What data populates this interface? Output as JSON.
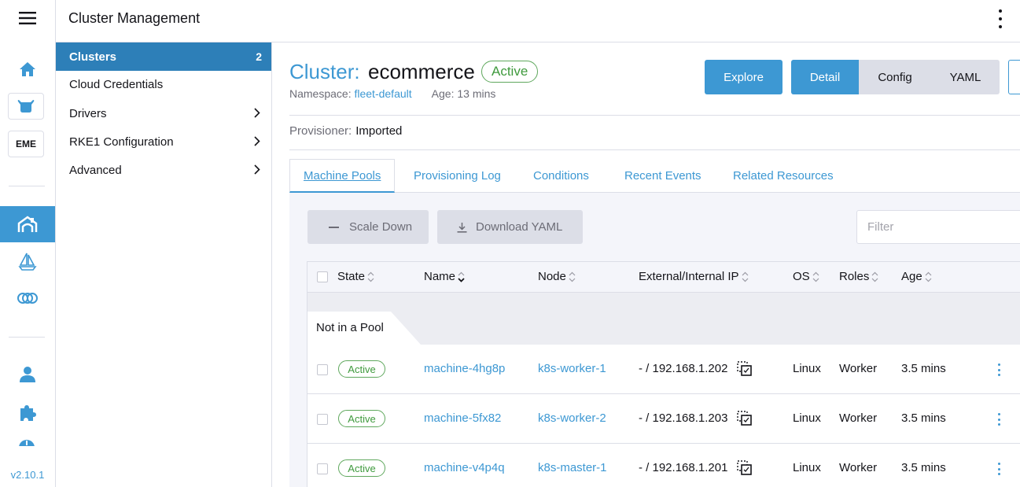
{
  "app": {
    "product_title": "Cluster Management",
    "version": "v2.10.1",
    "rail_cluster_tile": "EME"
  },
  "icons": {
    "menu": "hamburger-icon",
    "home": "home-icon",
    "cluster_rancher": "cattle-icon",
    "cluster_mgmt": "cluster-management-icon",
    "fleet": "sailboat-icon",
    "virtualization": "harvester-icon",
    "users": "user-icon",
    "extensions": "puzzle-icon",
    "more": "kebab-icon"
  },
  "sidenav": {
    "items": [
      {
        "label": "Clusters",
        "count": "2"
      },
      {
        "label": "Cloud Credentials"
      },
      {
        "label": "Drivers"
      },
      {
        "label": "RKE1 Configuration"
      },
      {
        "label": "Advanced"
      }
    ]
  },
  "cluster": {
    "prefix": "Cluster:",
    "name": "ecommerce",
    "status": "Active",
    "namespace_label": "Namespace:",
    "namespace": "fleet-default",
    "age_label": "Age:",
    "age": "13 mins",
    "provisioner_label": "Provisioner:",
    "provisioner": "Imported"
  },
  "actions": {
    "explore": "Explore",
    "detail": "Detail",
    "config": "Config",
    "yaml": "YAML"
  },
  "tabs": [
    "Machine Pools",
    "Provisioning Log",
    "Conditions",
    "Recent Events",
    "Related Resources"
  ],
  "toolbar": {
    "scale_down": "Scale Down",
    "download_yaml": "Download YAML",
    "filter_placeholder": "Filter"
  },
  "table": {
    "columns": [
      "State",
      "Name",
      "Node",
      "External/Internal IP",
      "OS",
      "Roles",
      "Age"
    ],
    "group_label": "Not in a Pool",
    "rows": [
      {
        "state": "Active",
        "name": "machine-4hg8p",
        "node": "k8s-worker-1",
        "ip": "- / 192.168.1.202",
        "os": "Linux",
        "roles": "Worker",
        "age": "3.5 mins"
      },
      {
        "state": "Active",
        "name": "machine-5fx82",
        "node": "k8s-worker-2",
        "ip": "- / 192.168.1.203",
        "os": "Linux",
        "roles": "Worker",
        "age": "3.5 mins"
      },
      {
        "state": "Active",
        "name": "machine-v4p4q",
        "node": "k8s-master-1",
        "ip": "- / 192.168.1.201",
        "os": "Linux",
        "roles": "Worker",
        "age": "3.5 mins"
      }
    ]
  },
  "colors": {
    "accent": "#3d98d3",
    "active_nav": "#2d7fb8",
    "success": "#3f9a3d",
    "border": "#dcdee7"
  }
}
